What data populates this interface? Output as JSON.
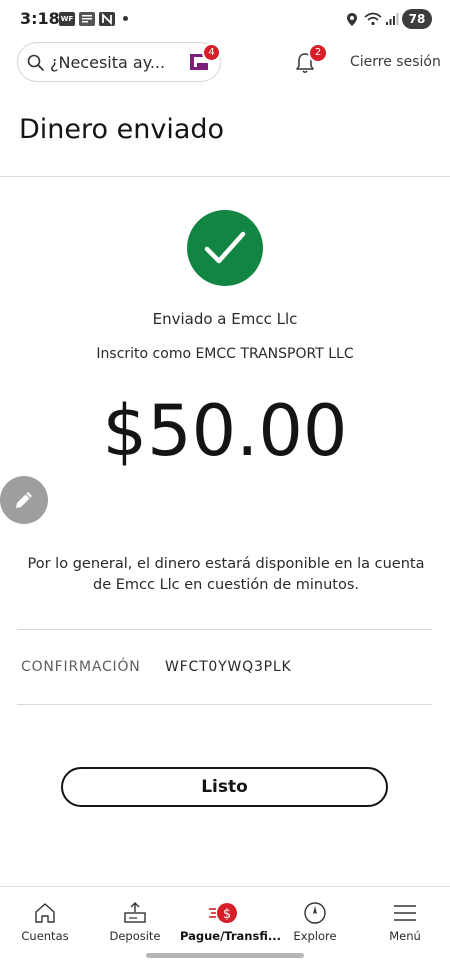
{
  "status_bar": {
    "time": "3:18",
    "apps": [
      "WF",
      "news-icon",
      "n-app-icon"
    ],
    "battery": "78"
  },
  "header": {
    "search_placeholder": "¿Necesita ay...",
    "fargo_badge": "4",
    "notifications_badge": "2",
    "logout_label": "Cierre sesión"
  },
  "page": {
    "title": "Dinero enviado"
  },
  "confirmation_panel": {
    "sent_to": "Enviado a Emcc Llc",
    "registered_as": "Inscrito como EMCC TRANSPORT LLC",
    "amount": "$50.00",
    "info": "Por lo general, el dinero estará disponible en la cuenta de Emcc Llc en cuestión de minutos.",
    "confirmation_label": "CONFIRMACIÓN",
    "confirmation_number": "WFCT0YWQ3PLK",
    "done_label": "Listo"
  },
  "bottom_nav": {
    "items": [
      {
        "label": "Cuentas",
        "icon": "home-icon"
      },
      {
        "label": "Deposite",
        "icon": "deposit-icon"
      },
      {
        "label": "Pague/Transfi...",
        "icon": "pay-transfer-icon"
      },
      {
        "label": "Explore",
        "icon": "compass-icon"
      },
      {
        "label": "Menú",
        "icon": "menu-icon"
      }
    ]
  },
  "colors": {
    "success_green": "#138542",
    "badge_red": "#d71e28",
    "brand_purple": "#7b1f7b"
  }
}
